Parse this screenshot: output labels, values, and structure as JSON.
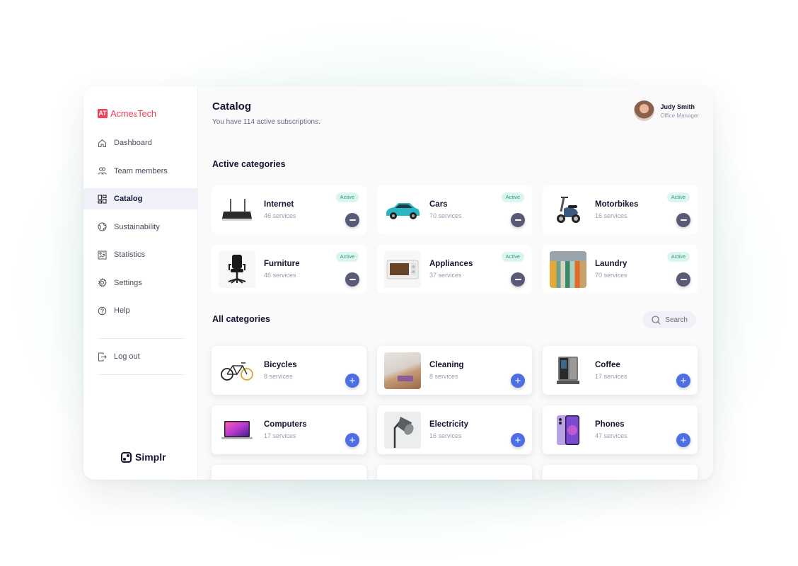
{
  "brand": {
    "mark": "AT",
    "name_part1": "Acme",
    "amp": "&",
    "name_part2": "Tech",
    "color": "#ef3f5a"
  },
  "sidebar": {
    "items": [
      {
        "label": "Dashboard",
        "icon": "home-icon",
        "active": false
      },
      {
        "label": "Team members",
        "icon": "users-icon",
        "active": false
      },
      {
        "label": "Catalog",
        "icon": "catalog-grid-icon",
        "active": true
      },
      {
        "label": "Sustainability",
        "icon": "globe-icon",
        "active": false
      },
      {
        "label": "Statistics",
        "icon": "statistics-icon",
        "active": false
      },
      {
        "label": "Settings",
        "icon": "gear-icon",
        "active": false
      },
      {
        "label": "Help",
        "icon": "help-icon",
        "active": false
      }
    ],
    "logout": {
      "label": "Log out",
      "icon": "logout-icon"
    },
    "footer_logo": "Simplr"
  },
  "header": {
    "title": "Catalog",
    "subtitle": "You have 114 active subscriptions.",
    "user": {
      "name": "Judy Smith",
      "role": "Office Manager"
    }
  },
  "active_section": {
    "title": "Active categories",
    "badge_label": "Active",
    "items": [
      {
        "name": "Internet",
        "count": "46 services",
        "image": "router"
      },
      {
        "name": "Cars",
        "count": "70 services",
        "image": "car"
      },
      {
        "name": "Motorbikes",
        "count": "16 services",
        "image": "scooter"
      },
      {
        "name": "Furniture",
        "count": "46 services",
        "image": "office-chair"
      },
      {
        "name": "Appliances",
        "count": "37 services",
        "image": "microwave"
      },
      {
        "name": "Laundry",
        "count": "70 services",
        "image": "clothes-rack"
      }
    ]
  },
  "all_section": {
    "title": "All categories",
    "search_label": "Search",
    "items": [
      {
        "name": "Bicycles",
        "count": "8 services",
        "image": "bicycle"
      },
      {
        "name": "Cleaning",
        "count": "8 services",
        "image": "cleaning-spray"
      },
      {
        "name": "Coffee",
        "count": "17 services",
        "image": "coffee-machine"
      },
      {
        "name": "Computers",
        "count": "17 services",
        "image": "laptop"
      },
      {
        "name": "Electricity",
        "count": "16 services",
        "image": "desk-lamp"
      },
      {
        "name": "Phones",
        "count": "47 services",
        "image": "smartphone"
      }
    ]
  },
  "colors": {
    "accent_add": "#4d6fe3",
    "remove": "#585a78",
    "active_badge_bg": "#dcf5ef",
    "active_badge_text": "#2a9a80"
  }
}
